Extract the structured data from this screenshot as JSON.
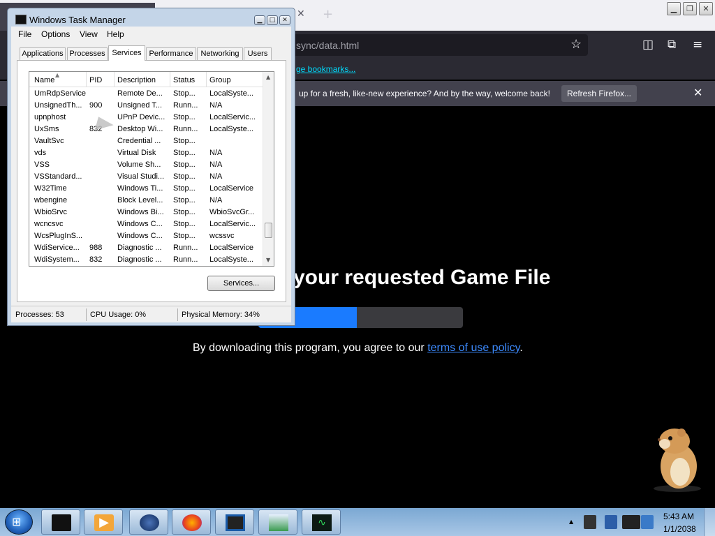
{
  "firefox": {
    "url_fragment": "sync/data.html",
    "bookmarks_link": "ge bookmarks...",
    "notification_text": "up for a fresh, like-new experience? And by the way, welcome back!",
    "refresh_button": "Refresh Firefox...",
    "tab_close": "✕",
    "new_tab": "+",
    "notify_close": "✕",
    "star": "☆"
  },
  "webpage": {
    "heading": "your requested Game File",
    "progress_fraction": 0.48,
    "agree_prefix": "By downloading this program, you agree to our ",
    "agree_link": "terms of use policy",
    "agree_suffix": "."
  },
  "task_manager": {
    "title": "Windows Task Manager",
    "menus": [
      "File",
      "Options",
      "View",
      "Help"
    ],
    "tabs": [
      "Applications",
      "Processes",
      "Services",
      "Performance",
      "Networking",
      "Users"
    ],
    "active_tab": "Services",
    "columns": [
      "Name",
      "PID",
      "Description",
      "Status",
      "Group"
    ],
    "rows": [
      [
        "UmRdpService",
        "",
        "Remote De...",
        "Stop...",
        "LocalSyste..."
      ],
      [
        "UnsignedTh...",
        "900",
        "Unsigned T...",
        "Runn...",
        "N/A"
      ],
      [
        "upnphost",
        "",
        "UPnP Devic...",
        "Stop...",
        "LocalServic..."
      ],
      [
        "UxSms",
        "832",
        "Desktop Wi...",
        "Runn...",
        "LocalSyste..."
      ],
      [
        "VaultSvc",
        "",
        "Credential ...",
        "Stop...",
        ""
      ],
      [
        "vds",
        "",
        "Virtual Disk",
        "Stop...",
        "N/A"
      ],
      [
        "VSS",
        "",
        "Volume Sh...",
        "Stop...",
        "N/A"
      ],
      [
        "VSStandard...",
        "",
        "Visual Studi...",
        "Stop...",
        "N/A"
      ],
      [
        "W32Time",
        "",
        "Windows Ti...",
        "Stop...",
        "LocalService"
      ],
      [
        "wbengine",
        "",
        "Block Level...",
        "Stop...",
        "N/A"
      ],
      [
        "WbioSrvc",
        "",
        "Windows Bi...",
        "Stop...",
        "WbioSvcGr..."
      ],
      [
        "wcncsvc",
        "",
        "Windows C...",
        "Stop...",
        "LocalServic..."
      ],
      [
        "WcsPlugInS...",
        "",
        "Windows C...",
        "Stop...",
        "wcssvc"
      ],
      [
        "WdiService...",
        "988",
        "Diagnostic ...",
        "Runn...",
        "LocalService"
      ],
      [
        "WdiSystem...",
        "832",
        "Diagnostic ...",
        "Runn...",
        "LocalSyste..."
      ]
    ],
    "services_button": "Services...",
    "status": {
      "processes": "Processes: 53",
      "cpu": "CPU Usage: 0%",
      "memory": "Physical Memory: 34%"
    }
  },
  "taskbar": {
    "time": "5:43 AM",
    "date": "1/1/2038",
    "start_glyph": "⊞"
  }
}
